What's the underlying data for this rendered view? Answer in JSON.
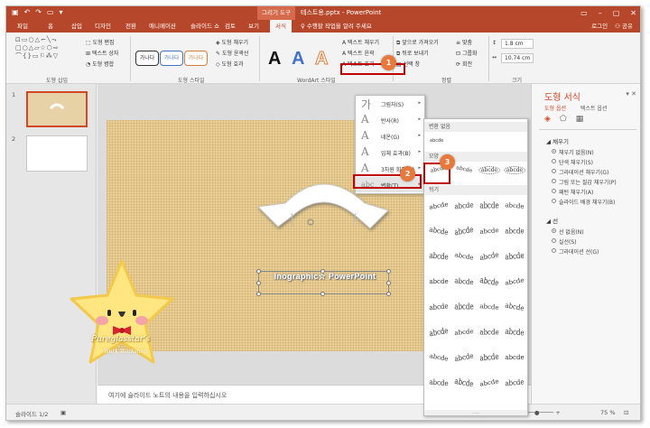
{
  "window": {
    "context_tab": "그리기 도구",
    "title": "테스트용.pptx - PowerPoint",
    "login": "로그인",
    "share": "공유",
    "accent": "#b7472a"
  },
  "tabs": [
    "파일",
    "홈",
    "삽입",
    "디자인",
    "전환",
    "애니메이션",
    "슬라이드 쇼",
    "검토",
    "보기",
    "서식"
  ],
  "tell_me": "수행할 작업을 알려 주세요",
  "ribbon": {
    "insert_shapes": {
      "label": "도형 삽입",
      "edit_shape": "도형 편집",
      "text_box": "텍스트 상자",
      "merge": "도형 병합"
    },
    "shape_styles": {
      "label": "도형 스타일",
      "sample": "가나다",
      "fill": "도형 채우기",
      "outline": "도형 윤곽선",
      "effects": "도형 효과"
    },
    "wordart": {
      "label": "WordArt 스타일",
      "glyph": "A",
      "text_fill": "텍스트 채우기",
      "text_outline": "텍스트 윤곽",
      "text_effects": "텍스트 효과"
    },
    "arrange": {
      "label": "정렬",
      "bring_forward": "앞으로 가져오기",
      "send_backward": "뒤로 보내기",
      "selection_pane": "선택 창",
      "align": "맞춤",
      "group": "그룹화",
      "rotate": "회전"
    },
    "size": {
      "label": "크기",
      "height": "1.8 cm",
      "width": "10.74 cm"
    }
  },
  "thumbnails": [
    {
      "num": "1"
    },
    {
      "num": "2"
    }
  ],
  "slide": {
    "text": "Inographic☆ PowerPoint"
  },
  "mascot": {
    "line1": "Pureglasstar's",
    "line2": "Work Workshop"
  },
  "notes_placeholder": "여기에 슬라이드 노트의 내용을 입력하십시오",
  "status": {
    "slide": "슬라이드 1/2",
    "zoom": "75 %"
  },
  "effects_menu": [
    {
      "label": "그림자(S)",
      "icon": "가"
    },
    {
      "label": "반사(R)",
      "icon": "A"
    },
    {
      "label": "네온(G)",
      "icon": "A"
    },
    {
      "label": "입체 효과(B)",
      "icon": "A"
    },
    {
      "label": "3차원 회전(D)",
      "icon": "A"
    },
    {
      "label": "변환(T)",
      "icon": "abc"
    }
  ],
  "transform_menu": {
    "no_transform": "변환 없음",
    "none_sample": "abcde",
    "follow_path": "모양",
    "warp": "뒤기",
    "sample": "abcde",
    "path_samples": [
      "abcde",
      "abcde",
      "abcde",
      "abcde"
    ],
    "more": "....."
  },
  "format_pane": {
    "title": "도형 서식",
    "tabs": [
      "도형 옵션",
      "텍스트 옵션"
    ],
    "fill_section": "채우기",
    "fill_options": [
      "채우기 없음(N)",
      "단색 채우기(S)",
      "그라데이션 채우기(G)",
      "그림 또는 질감 채우기(P)",
      "패턴 채우기(A)",
      "슬라이드 배경 채우기(B)"
    ],
    "line_section": "선",
    "line_options": [
      "선 없음(N)",
      "실선(S)",
      "그라데이션 선(G)"
    ]
  },
  "steps": [
    "1",
    "2",
    "3"
  ]
}
